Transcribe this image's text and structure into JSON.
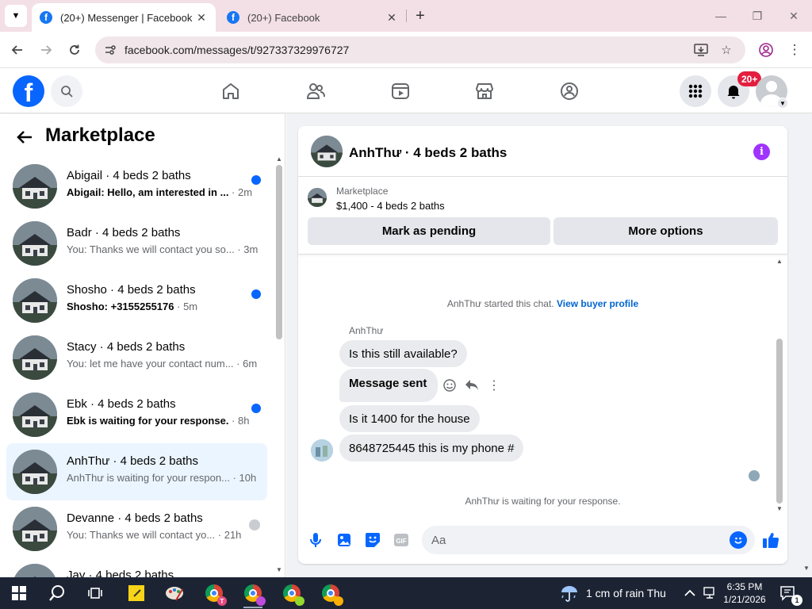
{
  "browser": {
    "tabs": [
      {
        "title": "(20+) Messenger | Facebook",
        "active": true
      },
      {
        "title": "(20+) Facebook",
        "active": false
      }
    ],
    "url": "facebook.com/messages/t/927337329976727"
  },
  "fb_nav": {
    "notification_count": "20+"
  },
  "left_panel": {
    "title": "Marketplace",
    "conversations": [
      {
        "name": "Abigail · 4 beds 2 baths",
        "snippet": "Abigail: Hello, am interested in ...",
        "time": "2m",
        "unread": true
      },
      {
        "name": "Badr · 4 beds 2 baths",
        "snippet": "You: Thanks we will contact you so...",
        "time": "3m",
        "unread": false
      },
      {
        "name": "Shosho · 4 beds 2 baths",
        "snippet": "Shosho: +3155255176",
        "time": "5m",
        "unread": true
      },
      {
        "name": "Stacy · 4 beds 2 baths",
        "snippet": "You: let me have your contact num...",
        "time": "6m",
        "unread": false
      },
      {
        "name": "Ebk · 4 beds 2 baths",
        "snippet": "Ebk is waiting for your response.",
        "time": "8h",
        "unread": true
      },
      {
        "name": "AnhThư · 4 beds 2 baths",
        "snippet": "AnhThư is waiting for your respon...",
        "time": "10h",
        "unread": false,
        "selected": true
      },
      {
        "name": "Devanne · 4 beds 2 baths",
        "snippet": "You: Thanks we will contact yo...",
        "time": "21h",
        "unread": false
      },
      {
        "name": "Jay · 4 beds 2 baths",
        "snippet": "",
        "time": "",
        "unread": false
      }
    ]
  },
  "chat": {
    "title": "AnhThư · 4 beds 2 baths",
    "listing": {
      "label": "Marketplace",
      "price_line": "$1,400 - 4 beds 2 baths",
      "mark_pending": "Mark as pending",
      "more_options": "More options"
    },
    "started_text": "AnhThư started this chat.",
    "view_profile": "View buyer profile",
    "sender": "AnhThư",
    "messages": [
      "Is this still available?",
      "Message sent",
      "Is it 1400 for the house",
      "8648725445 this is my phone #"
    ],
    "waiting_text": "AnhThư is waiting for your response.",
    "composer_placeholder": "Aa"
  },
  "taskbar": {
    "weather": "1 cm of rain Thu",
    "time": "6:35 PM",
    "date": "1/21/2026",
    "notifications": "1"
  },
  "colors": {
    "fb_blue": "#0866ff",
    "unread_dot": "#0866ff",
    "badge_red": "#e41e3f",
    "info_purple": "#a033ff",
    "selected_row": "#ebf5ff"
  }
}
